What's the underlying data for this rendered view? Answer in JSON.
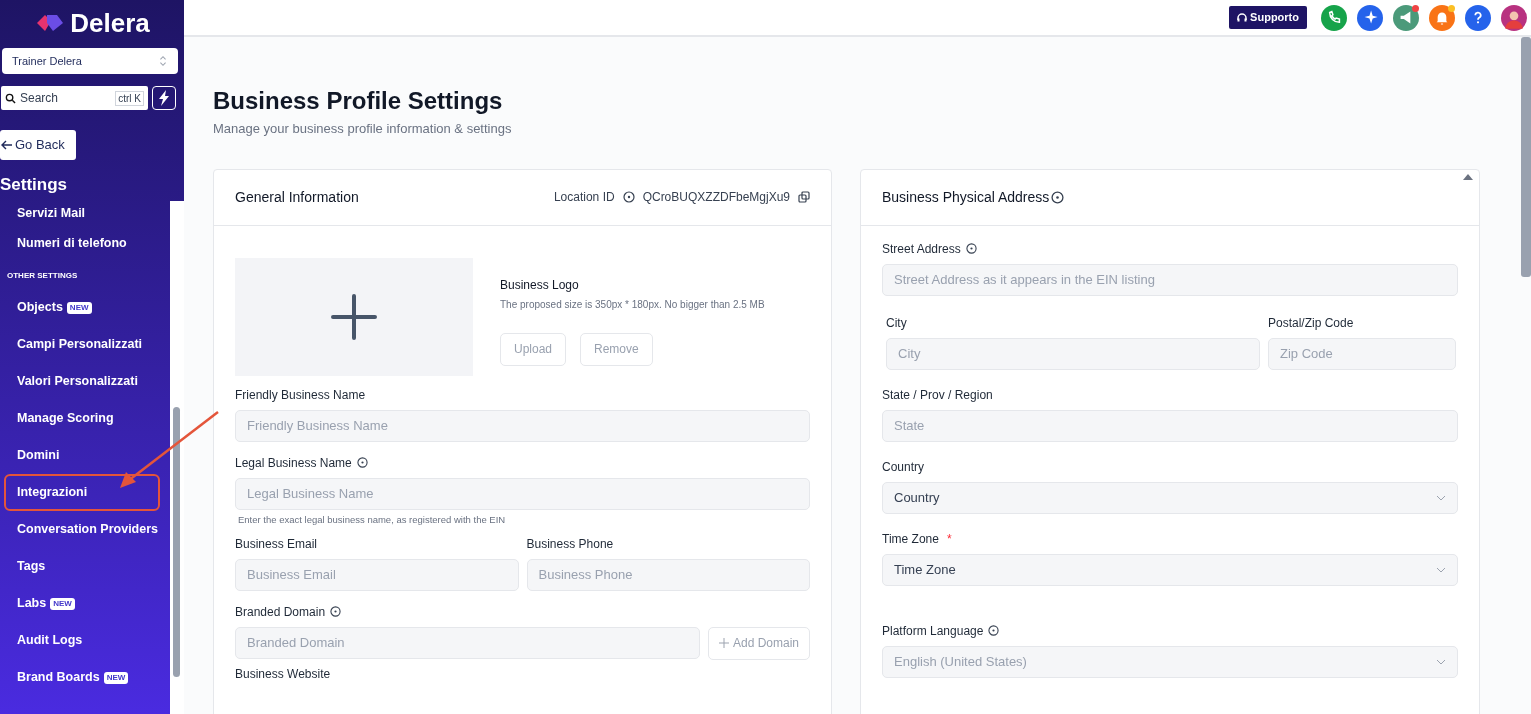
{
  "sidebar": {
    "logo": {
      "name": "Delera"
    },
    "account_switcher": {
      "value": "Trainer Delera"
    },
    "search": {
      "placeholder": "Search",
      "shortcut": "ctrl K"
    },
    "go_back": "Go Back",
    "heading": "Settings",
    "items": [
      {
        "kind": "item",
        "label": "Servizi Mail",
        "highlighted": false
      },
      {
        "kind": "item",
        "label": "Numeri di telefono",
        "highlighted": false
      },
      {
        "kind": "section",
        "label": "OTHER SETTINGS"
      },
      {
        "kind": "item",
        "label": "Objects",
        "badge": "NEW",
        "highlighted": false
      },
      {
        "kind": "item",
        "label": "Campi Personalizzati",
        "highlighted": false
      },
      {
        "kind": "item",
        "label": "Valori Personalizzati",
        "highlighted": false
      },
      {
        "kind": "item",
        "label": "Manage Scoring",
        "highlighted": false
      },
      {
        "kind": "item",
        "label": "Domini",
        "highlighted": false
      },
      {
        "kind": "item",
        "label": "Integrazioni",
        "highlighted": true
      },
      {
        "kind": "item",
        "label": "Conversation Providers",
        "highlighted": false
      },
      {
        "kind": "item",
        "label": "Tags",
        "highlighted": false
      },
      {
        "kind": "item",
        "label": "Labs",
        "badge": "NEW",
        "highlighted": false
      },
      {
        "kind": "item",
        "label": "Audit Logs",
        "highlighted": false
      },
      {
        "kind": "item",
        "label": "Brand Boards",
        "badge": "NEW",
        "highlighted": false
      }
    ]
  },
  "topbar": {
    "support": "Supporto",
    "icons": [
      {
        "kind": "phone",
        "color": "#16a34a",
        "dot": false
      },
      {
        "kind": "sparkle",
        "color": "#2563eb",
        "dot": false
      },
      {
        "kind": "megaphone",
        "color": "#4b9a7a",
        "dot": true
      },
      {
        "kind": "bell",
        "color": "#f97316",
        "dot": true
      },
      {
        "kind": "help",
        "color": "#2563eb",
        "dot": false
      },
      {
        "kind": "avatar",
        "color": "#b83280",
        "dot": false
      }
    ]
  },
  "page": {
    "title": "Business Profile Settings",
    "subtitle": "Manage your business profile information & settings"
  },
  "general": {
    "title": "General Information",
    "location_label": "Location ID",
    "location_id": "QCroBUQXZZDFbeMgjXu9",
    "logo": {
      "title": "Business Logo",
      "hint": "The proposed size is 350px * 180px. No bigger than 2.5 MB",
      "buttons": [
        "Upload",
        "Remove"
      ]
    },
    "fields": [
      {
        "label": "Friendly Business Name",
        "placeholder": "Friendly Business Name"
      },
      {
        "label": "Legal Business Name",
        "info": true,
        "placeholder": "Legal Business Name",
        "help": "Enter the exact legal business name, as registered with the EIN"
      }
    ],
    "pair": [
      {
        "label": "Business Email",
        "placeholder": "Business Email"
      },
      {
        "label": "Business Phone",
        "placeholder": "Business Phone"
      }
    ],
    "domain": {
      "label": "Branded Domain",
      "placeholder": "Branded Domain",
      "button": "Add Domain"
    },
    "next_label": "Business Website"
  },
  "address": {
    "title": "Business Physical Address",
    "street": {
      "label": "Street Address",
      "placeholder": "Street Address as it appears in the EIN listing"
    },
    "city": {
      "label": "City",
      "placeholder": "City"
    },
    "zip": {
      "label": "Postal/Zip Code",
      "placeholder": "Zip Code"
    },
    "state": {
      "label": "State / Prov / Region",
      "placeholder": "State"
    },
    "selects": [
      {
        "label": "Country",
        "value": "Country",
        "disabled": false
      },
      {
        "label": "Time Zone",
        "value": "Time Zone",
        "required_mark": "*",
        "disabled": false
      },
      {
        "label": "Platform Language",
        "value": "English (United States)",
        "info": true,
        "disabled": true
      }
    ]
  }
}
